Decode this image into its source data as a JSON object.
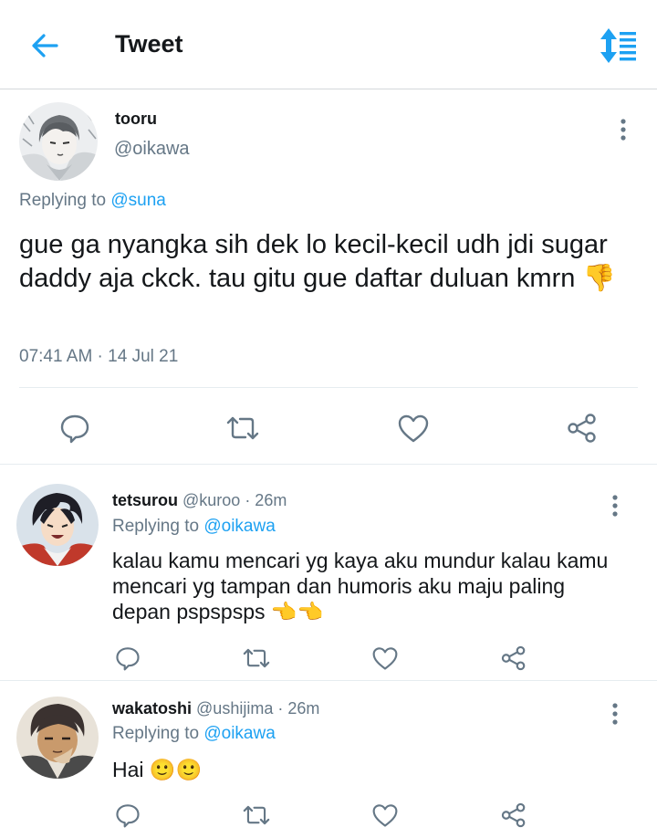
{
  "header": {
    "title": "Tweet",
    "back_icon": "arrow-left-icon",
    "sort_icon": "sort-icon",
    "accent_color": "#1da1f2"
  },
  "main_tweet": {
    "name": "tooru",
    "handle": "@oikawa",
    "replying_prefix": "Replying to",
    "replying_to": "@suna",
    "text": "gue ga nyangka sih dek lo kecil-kecil udh jdi sugar daddy aja ckck. tau gitu gue daftar duluan kmrn",
    "emoji": "👎",
    "timestamp": "07:41 AM · 14 Jul 21",
    "actions": [
      "reply-icon",
      "retweet-icon",
      "like-icon",
      "share-icon"
    ]
  },
  "replies": [
    {
      "name": "tetsurou",
      "handle": "@kuroo",
      "time": "· 26m",
      "replying_prefix": "Replying to",
      "replying_to": "@oikawa",
      "text": "kalau kamu mencari yg kaya aku mundur kalau kamu mencari yg tampan dan humoris aku maju paling depan pspspsps",
      "emoji": "👈👈"
    },
    {
      "name": "wakatoshi",
      "handle": "@ushijima",
      "time": "· 26m",
      "replying_prefix": "Replying to",
      "replying_to": "@oikawa",
      "text": "Hai",
      "emoji": "🙂🙂"
    }
  ]
}
